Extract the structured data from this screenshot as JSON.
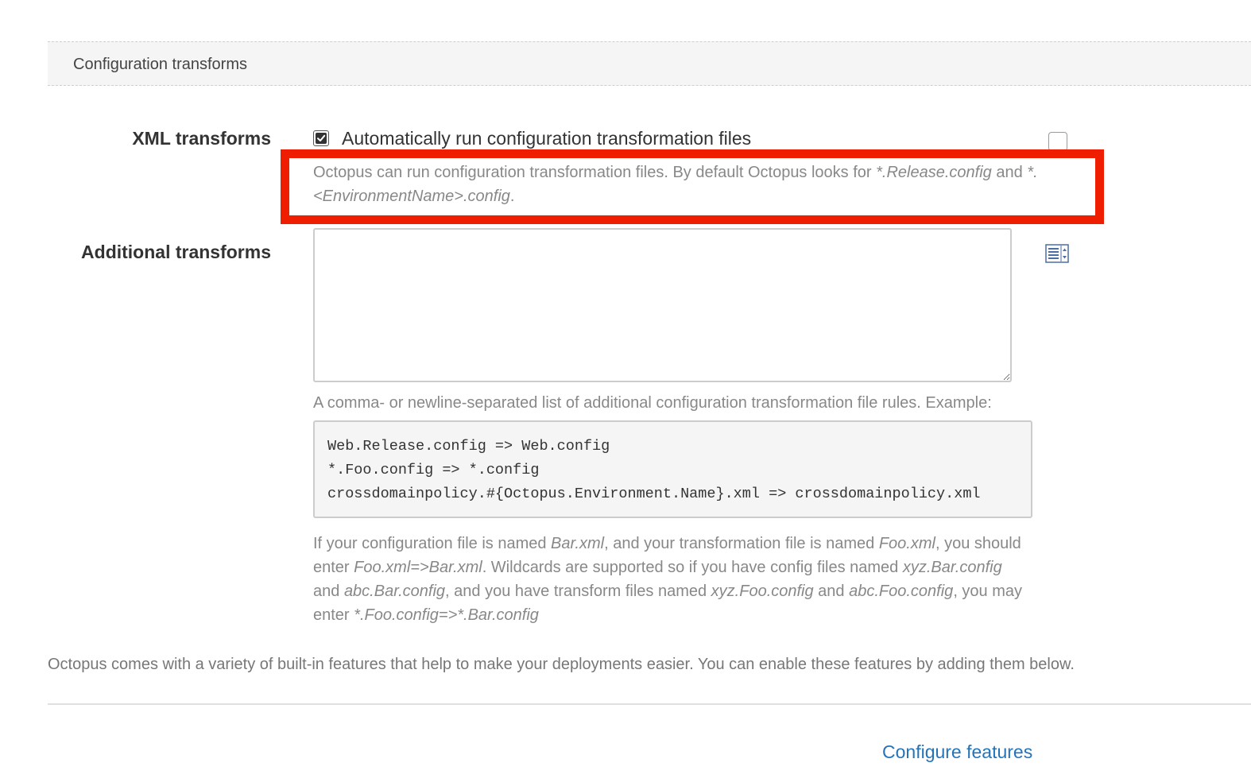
{
  "section": {
    "title": "Configuration transforms"
  },
  "xml_transforms": {
    "label": "XML transforms",
    "checkbox_checked": true,
    "checkbox_label": "Automatically run configuration transformation files",
    "help_prefix": "Octopus can run configuration transformation files. By default Octopus looks for ",
    "help_release_pattern": "*.Release.config",
    "help_and": " and ",
    "help_env_pattern": "*.<EnvironmentName>.config",
    "help_suffix": "."
  },
  "additional_transforms": {
    "label": "Additional transforms",
    "value": "",
    "example_intro": "A comma- or newline-separated list of additional configuration transformation file rules. Example:",
    "example_lines": [
      "Web.Release.config => Web.config",
      "*.Foo.config => *.config",
      "crossdomainpolicy.#{Octopus.Environment.Name}.xml => crossdomainpolicy.xml"
    ],
    "help": {
      "t1": "If your configuration file is named ",
      "i1": "Bar.xml",
      "t2": ", and your transformation file is named ",
      "i2": "Foo.xml",
      "t3": ", you should enter ",
      "i3": "Foo.xml=>Bar.xml",
      "t4": ". Wildcards are supported so if you have config files named ",
      "i4": "xyz.Bar.config",
      "t5": " and ",
      "i5": "abc.Bar.config",
      "t6": ", and you have transform files named ",
      "i6": "xyz.Foo.config",
      "t7": " and ",
      "i7": "abc.Foo.config",
      "t8": ", you may enter ",
      "i8": "*.Foo.config=>*.Bar.config"
    }
  },
  "features": {
    "intro": "Octopus comes with a variety of built-in features that help to make your deployments easier. You can enable these features by adding them below.",
    "configure_link": "Configure features"
  },
  "colors": {
    "highlight": "#f01e00",
    "link": "#2573b8"
  },
  "icons": {
    "checkbox": "checkmark-icon",
    "variable_picker": "variable-list-icon"
  }
}
